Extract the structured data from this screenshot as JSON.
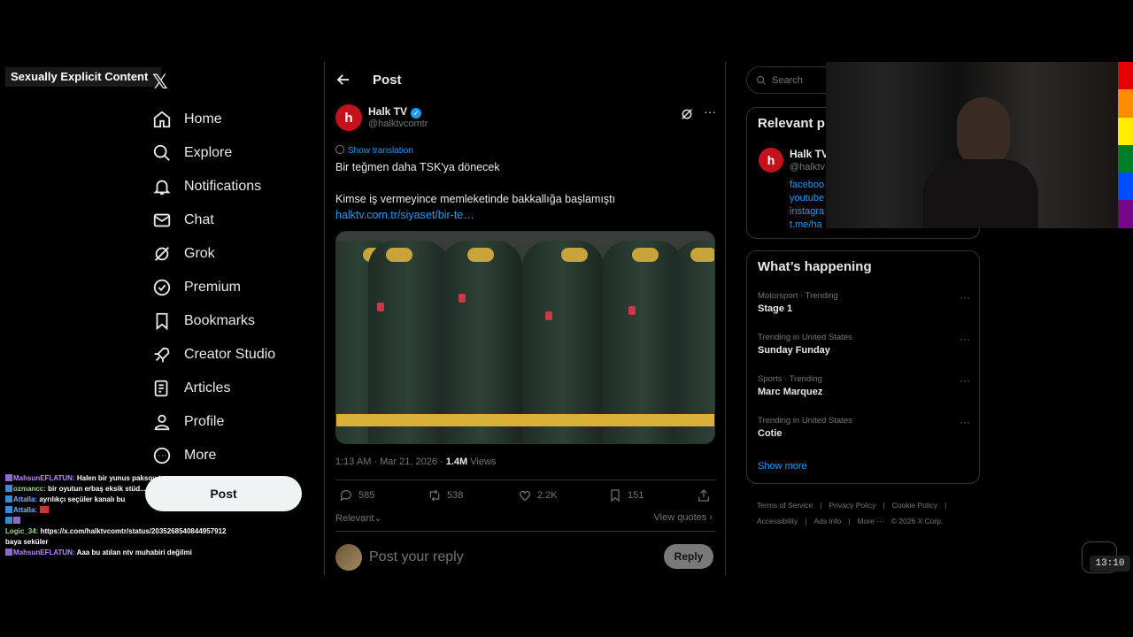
{
  "overlay": {
    "nsfw_label": "Sexually Explicit Content"
  },
  "nav": {
    "items": [
      {
        "label": "Home"
      },
      {
        "label": "Explore"
      },
      {
        "label": "Notifications"
      },
      {
        "label": "Chat"
      },
      {
        "label": "Grok"
      },
      {
        "label": "Premium"
      },
      {
        "label": "Bookmarks"
      },
      {
        "label": "Creator Studio"
      },
      {
        "label": "Articles"
      },
      {
        "label": "Profile"
      },
      {
        "label": "More"
      }
    ],
    "post_button": "Post"
  },
  "chat": [
    {
      "user": "MahsunEFLATUN:",
      "msg": "Halen bir yunus paksoy t..."
    },
    {
      "user": "ozmancc:",
      "msg": "bir oyutun erbaş eksik stüd..."
    },
    {
      "user": "Attalla:",
      "msg": "ayrılıkçı seçüler kanalı bu"
    },
    {
      "user": "Attalla:",
      "msg": ""
    },
    {
      "user": "",
      "msg": ""
    },
    {
      "user": "Logic_34:",
      "msg": "https://x.com/halktvcomtr/status/2035268540844957912"
    },
    {
      "user": "",
      "msg": "baya seküler"
    },
    {
      "user": "MahsunEFLATUN:",
      "msg": "Aaa bu atılan ntv muhabiri değilmi"
    }
  ],
  "main": {
    "title": "Post",
    "author": {
      "name": "Halk TV",
      "handle": "@halktvcomtr",
      "avatar_letter": "h"
    },
    "show_translation": "Show translation",
    "text_line1": "Bir teğmen daha TSK'ya dönecek",
    "text_line2": "Kimse iş vermeyince memleketinde bakkallığa başlamıştı",
    "link": "halktv.com.tr/siyaset/bir-te…",
    "time": "1:13 AM · Mar 21, 2026 · ",
    "views_count": "1.4M",
    "views_label": " Views",
    "actions": {
      "replies": "585",
      "reposts": "538",
      "likes": "2.2K",
      "bookmarks": "151"
    },
    "sort_label": "Relevant",
    "view_quotes": "View quotes",
    "reply_placeholder": "Post your reply",
    "reply_button": "Reply"
  },
  "right": {
    "search_placeholder": "Search",
    "relevant_title": "Relevant p",
    "relevant_name": "Halk TV",
    "relevant_handle": "@halktv",
    "relevant_links": [
      "faceboo",
      "youtube",
      "instagra",
      "t.me/ha"
    ],
    "whats_happening": "What’s happening",
    "trends": [
      {
        "meta": "Motorsport · Trending",
        "name": "Stage 1"
      },
      {
        "meta": "Trending in United States",
        "name": "Sunday Funday"
      },
      {
        "meta": "Sports · Trending",
        "name": "Marc Marquez"
      },
      {
        "meta": "Trending in United States",
        "name": "Cotie"
      }
    ],
    "show_more": "Show more",
    "footer": [
      "Terms of Service",
      "|",
      "Privacy Policy",
      "|",
      "Cookie Policy",
      "|",
      "Accessibility",
      "|",
      "Ads info",
      "|",
      "More ···",
      "© 2026 X Corp."
    ]
  },
  "clock": "13:10",
  "colors": {
    "accent": "#1d9bf0",
    "background": "#000000",
    "brand": "#c4121c"
  }
}
